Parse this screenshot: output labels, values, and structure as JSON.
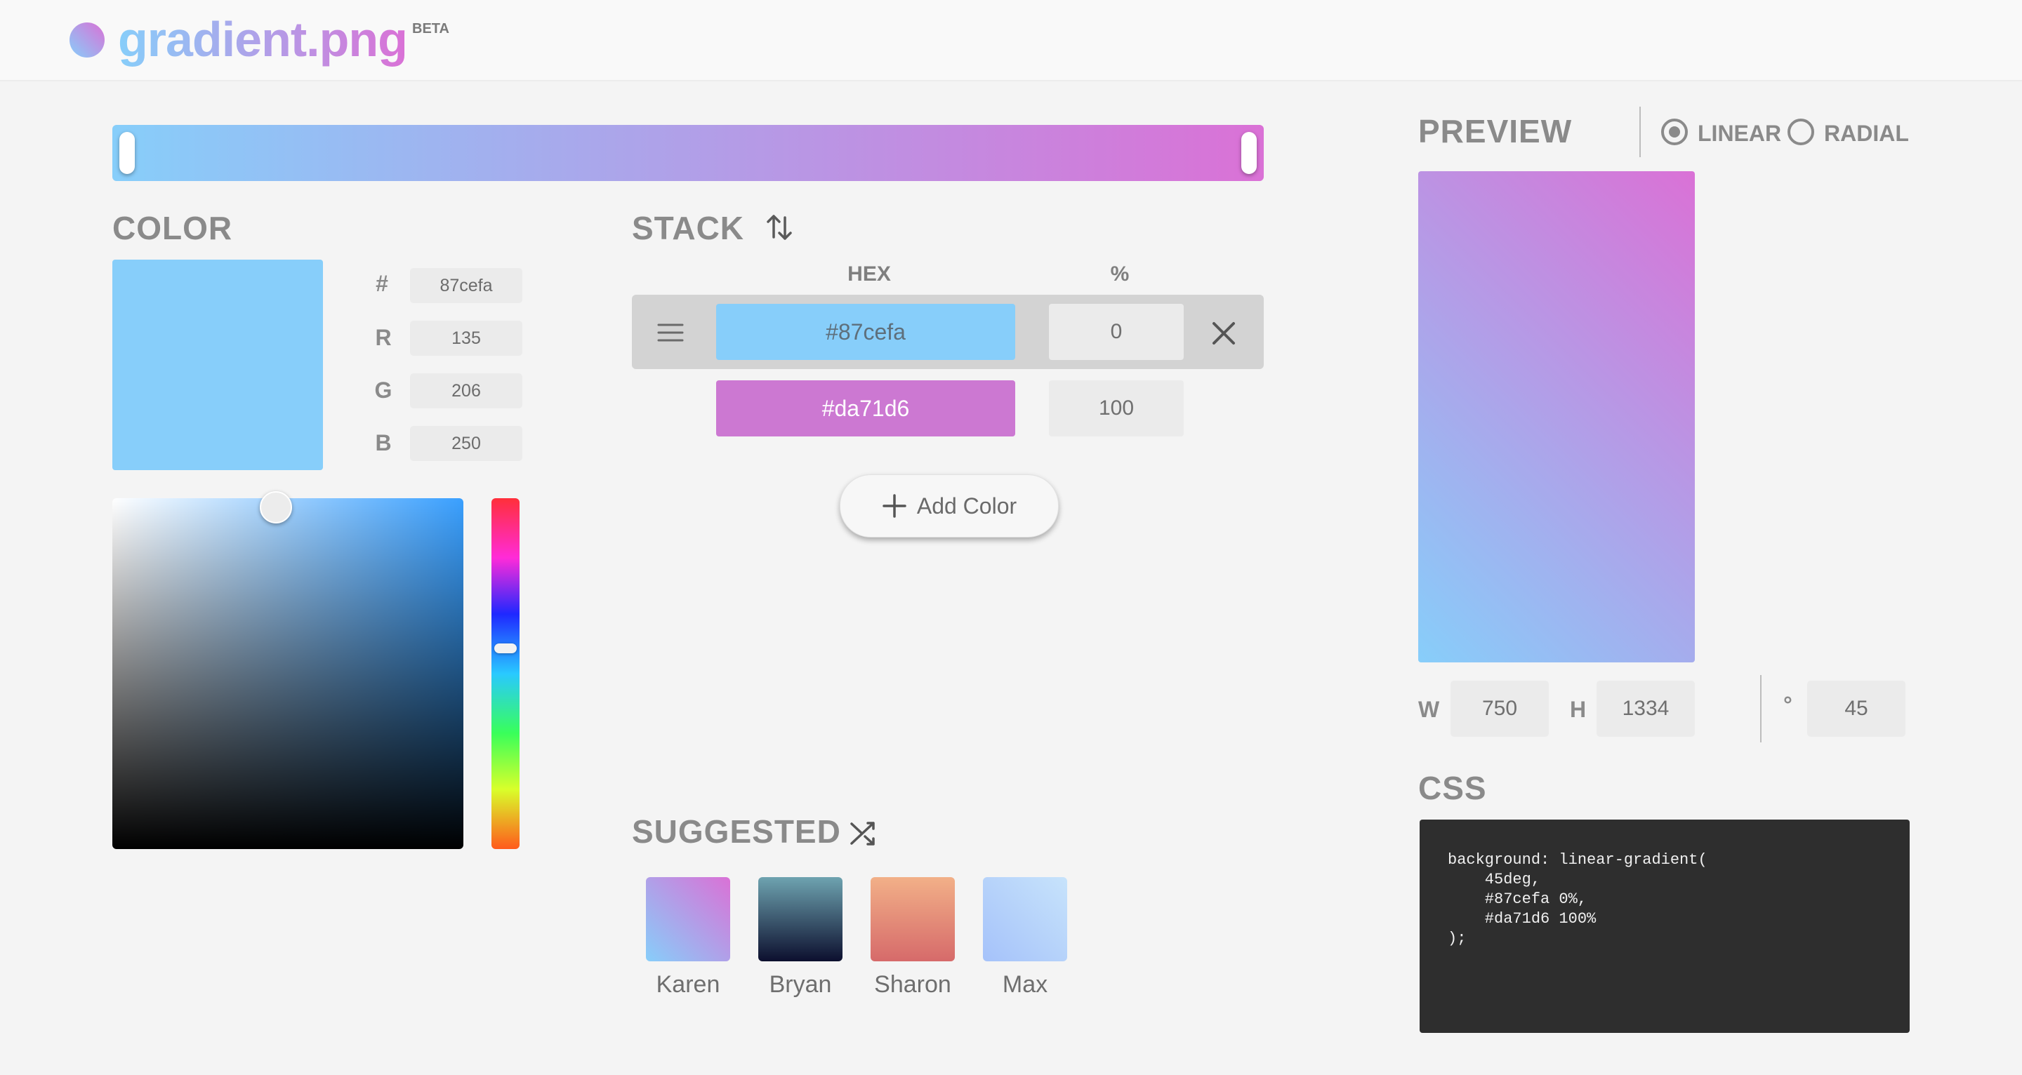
{
  "app": {
    "name": "gradient.png",
    "badge": "BETA"
  },
  "colors": {
    "stop1": "#87cefa",
    "stop2": "#da71d6",
    "accent_text": "#8a8a8a",
    "code_bg": "#2e2e2e"
  },
  "gradient_bar": {
    "stops_percent": [
      0,
      100
    ]
  },
  "color_panel": {
    "title": "COLOR",
    "hex_label": "#",
    "hex_value": "87cefa",
    "r_label": "R",
    "r_value": "135",
    "g_label": "G",
    "g_value": "206",
    "b_label": "B",
    "b_value": "250",
    "hue_icon": "hue-slider",
    "sv_icon": "saturation-value-picker"
  },
  "stack": {
    "title": "STACK",
    "sort_icon": "sort-arrows-icon",
    "col_hex": "HEX",
    "col_percent": "%",
    "rows": [
      {
        "hex": "#87cefa",
        "percent": "0",
        "color": "#87cefa"
      },
      {
        "hex": "#da71d6",
        "percent": "100",
        "color": "#cc78d2"
      }
    ],
    "add_label": "Add Color"
  },
  "suggested": {
    "title": "SUGGESTED",
    "shuffle_icon": "shuffle-icon",
    "items": [
      {
        "name": "Karen",
        "from": "#87cefa",
        "to": "#da71d6"
      },
      {
        "name": "Bryan",
        "from": "#6ea3b0",
        "to": "#0c0f2e"
      },
      {
        "name": "Sharon",
        "from": "#f2b088",
        "to": "#d66a6a"
      },
      {
        "name": "Max",
        "from": "#a5c2fa",
        "to": "#c7e3fb"
      }
    ]
  },
  "preview": {
    "title": "PREVIEW",
    "mode_linear": "LINEAR",
    "mode_radial": "RADIAL",
    "selected_mode": "LINEAR",
    "w_label": "W",
    "w_value": "750",
    "h_label": "H",
    "h_value": "1334",
    "angle_label": "°",
    "angle_value": "45"
  },
  "css": {
    "title": "CSS",
    "code": "background: linear-gradient(\n    45deg,\n    #87cefa 0%,\n    #da71d6 100%\n);"
  }
}
